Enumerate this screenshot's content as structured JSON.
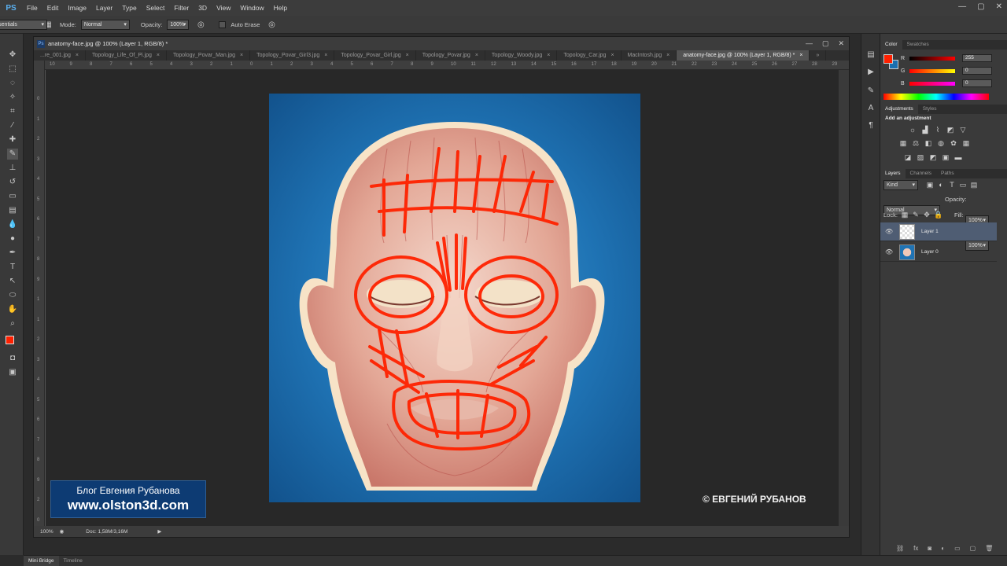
{
  "app": {
    "logo": "PS"
  },
  "menu": [
    "File",
    "Edit",
    "Image",
    "Layer",
    "Type",
    "Select",
    "Filter",
    "3D",
    "View",
    "Window",
    "Help"
  ],
  "options_bar": {
    "mode_label": "Mode:",
    "mode_value": "Normal",
    "opacity_label": "Opacity:",
    "opacity_value": "100%",
    "auto_erase_label": "Auto Erase",
    "workspace": "Essentials"
  },
  "document": {
    "title": "anatomy-face.jpg @ 100% (Layer 1, RGB/8) *",
    "tabs": [
      "...re_001.jpg",
      "Topology_Life_Of_Pi.jpg",
      "Topology_Povar_Man.jpg",
      "Topology_Povar_Girl3.jpg",
      "Topology_Povar_Girl.jpg",
      "Topology_Povar.jpg",
      "Topology_Woody.jpg",
      "Topology_Car.jpg",
      "MacIntosh.jpg",
      "anatomy-face.jpg @ 100% (Layer 1, RGB/8) *"
    ],
    "active_tab": 9,
    "ruler_h": [
      "10",
      "9",
      "8",
      "7",
      "6",
      "5",
      "4",
      "3",
      "2",
      "1",
      "0",
      "1",
      "2",
      "3",
      "4",
      "5",
      "6",
      "7",
      "8",
      "9",
      "10",
      "11",
      "12",
      "13",
      "14",
      "15",
      "16",
      "17",
      "18",
      "19",
      "20",
      "21",
      "22",
      "23",
      "24",
      "25",
      "26",
      "27",
      "28",
      "29"
    ],
    "ruler_v": [
      "0",
      "1",
      "2",
      "3",
      "4",
      "5",
      "6",
      "7",
      "8",
      "9",
      "1",
      "1",
      "2",
      "3",
      "4",
      "5",
      "6",
      "7",
      "8",
      "9",
      "2",
      "0"
    ],
    "zoom": "100%",
    "doc_size": "Doc: 1,58M/3,16M"
  },
  "overlay": {
    "blog_line1": "Блог Евгения Рубанова",
    "blog_line2": "www.olston3d.com",
    "copyright": "© ЕВГЕНИЙ РУБАНОВ"
  },
  "color_panel": {
    "tabs": [
      "Color",
      "Swatches"
    ],
    "channels": [
      {
        "label": "R",
        "value": "255"
      },
      {
        "label": "G",
        "value": "0"
      },
      {
        "label": "B",
        "value": "0"
      }
    ],
    "foreground": "#ff2000",
    "background": "#1a6fb0"
  },
  "adjustments_panel": {
    "tabs": [
      "Adjustments",
      "Styles"
    ],
    "hint": "Add an adjustment"
  },
  "layers_panel": {
    "tabs": [
      "Layers",
      "Channels",
      "Paths"
    ],
    "kind_label": "Kind",
    "blend_mode": "Normal",
    "opacity_label": "Opacity:",
    "opacity_value": "100%",
    "lock_label": "Lock:",
    "fill_label": "Fill:",
    "fill_value": "100%",
    "layers": [
      {
        "name": "Layer 1",
        "selected": true
      },
      {
        "name": "Layer 0",
        "selected": false
      }
    ]
  },
  "bottom_tabs": [
    "Mini Bridge",
    "Timeline"
  ]
}
